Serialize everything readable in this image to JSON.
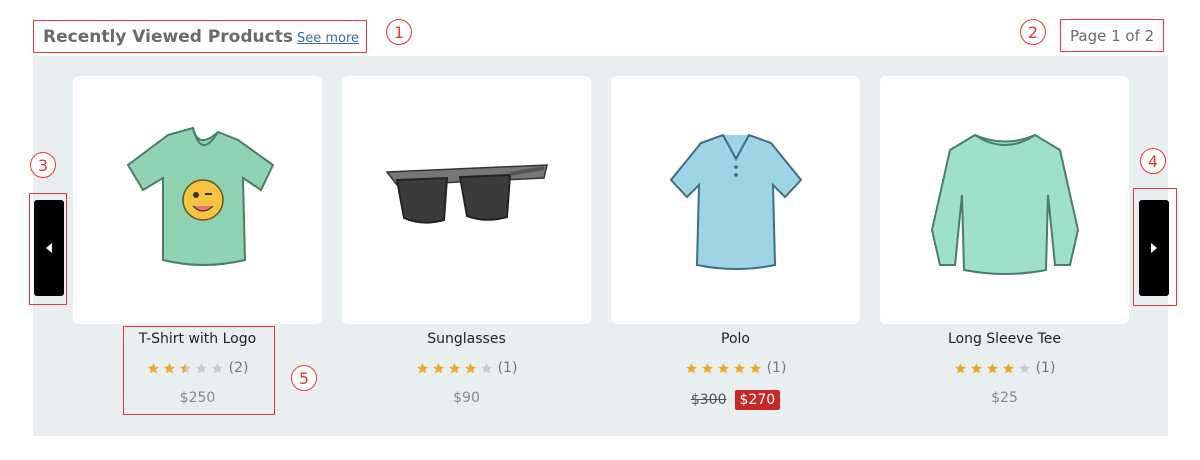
{
  "header": {
    "title": "Recently Viewed Products",
    "see_more": "See more",
    "page_indicator": "Page 1 of 2"
  },
  "annotations": [
    "1",
    "2",
    "3",
    "4",
    "5"
  ],
  "colors": {
    "accent_red": "#e53935",
    "star_filled": "#f5a623",
    "star_empty": "#cccccc",
    "sale_badge": "#c62828",
    "carousel_bg": "#e9eef1"
  },
  "products": [
    {
      "name": "T-Shirt with Logo",
      "image": "tshirt-logo",
      "rating": 2.5,
      "reviews": "(2)",
      "price": "$250"
    },
    {
      "name": "Sunglasses",
      "image": "sunglasses",
      "rating": 4,
      "reviews": "(1)",
      "price": "$90"
    },
    {
      "name": "Polo",
      "image": "polo",
      "rating": 5,
      "reviews": "(1)",
      "old_price": "$300",
      "price": "$270"
    },
    {
      "name": "Long Sleeve Tee",
      "image": "long-sleeve-tee",
      "rating": 4,
      "reviews": "(1)",
      "price": "$25"
    }
  ]
}
